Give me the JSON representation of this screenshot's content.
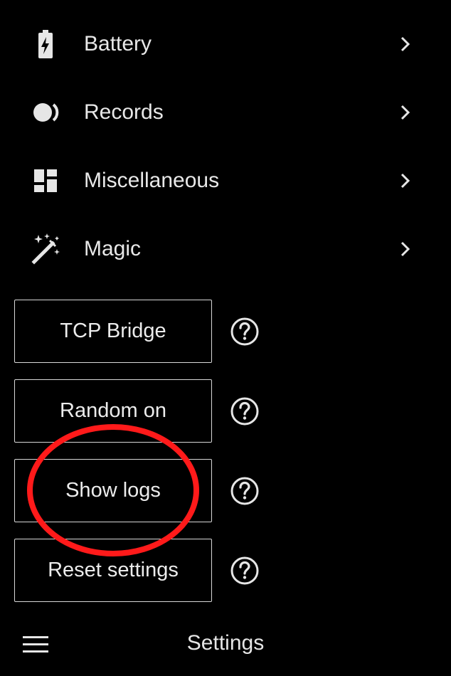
{
  "menu": {
    "items": [
      {
        "label": "Battery",
        "icon": "battery-charging-icon"
      },
      {
        "label": "Records",
        "icon": "records-icon"
      },
      {
        "label": "Miscellaneous",
        "icon": "dashboard-icon"
      },
      {
        "label": "Magic",
        "icon": "magic-wand-icon"
      }
    ]
  },
  "actions": {
    "buttons": [
      {
        "label": "TCP Bridge"
      },
      {
        "label": "Random on"
      },
      {
        "label": "Show logs"
      },
      {
        "label": "Reset settings"
      }
    ]
  },
  "annotation": {
    "color": "#ff1a1a",
    "target": "Show logs"
  },
  "bottom_bar": {
    "title": "Settings"
  },
  "colors": {
    "background": "#000000",
    "text": "#e6e6e6",
    "border": "#d8d8d8"
  }
}
